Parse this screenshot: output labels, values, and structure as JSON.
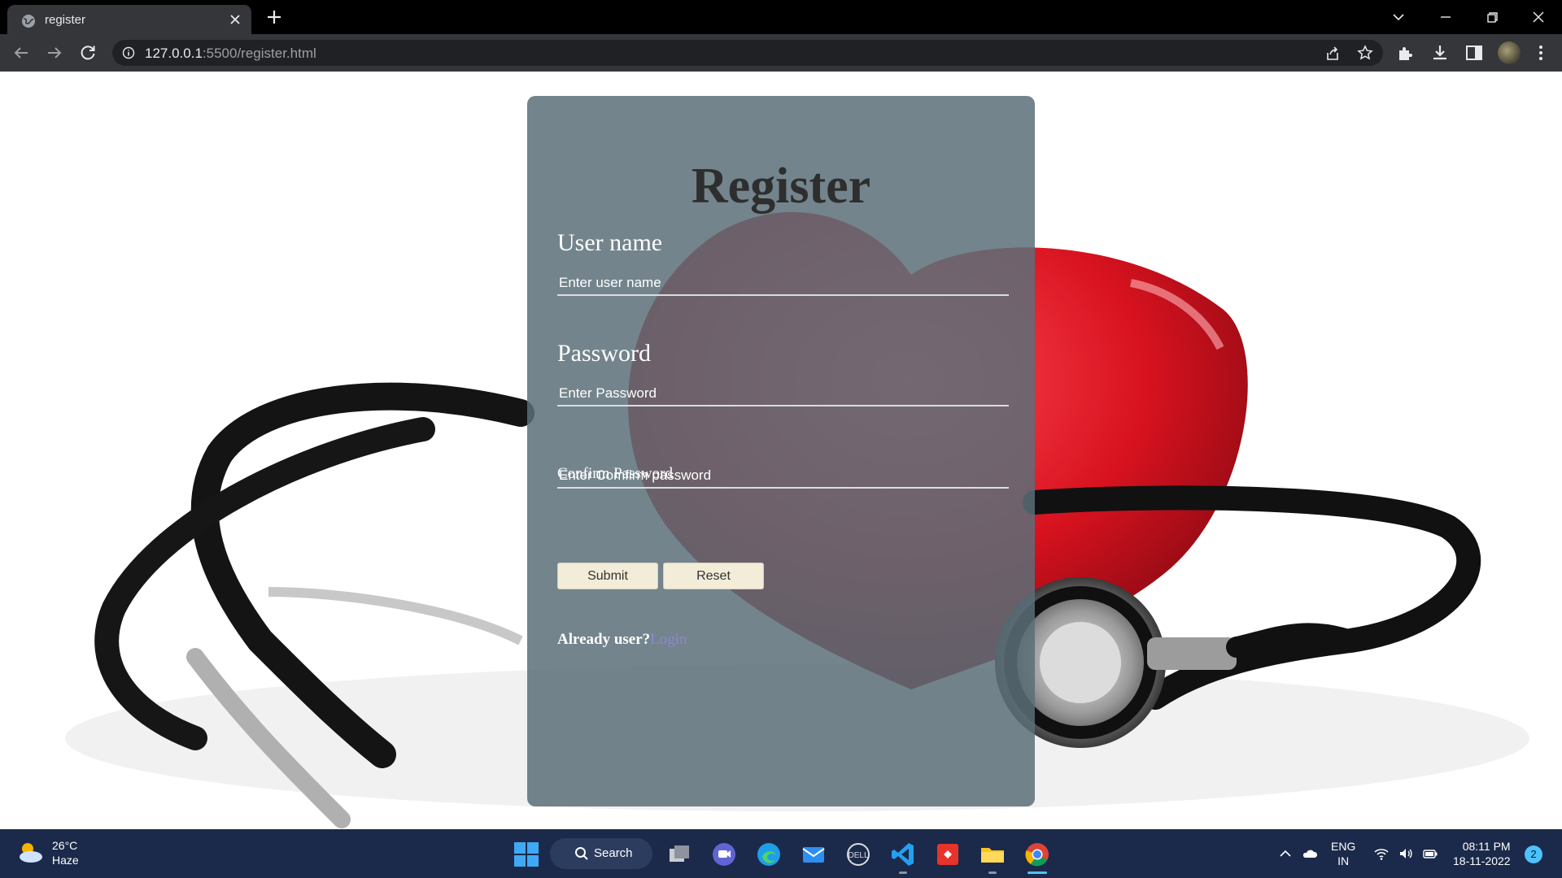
{
  "browser": {
    "tab_title": "register",
    "url_host": "127.0.0.1",
    "url_rest": ":5500/register.html"
  },
  "form": {
    "heading": "Register",
    "username_label": "User name",
    "username_placeholder": "Enter user name",
    "password_label": "Password",
    "password_placeholder": "Enter Password",
    "confirm_label": "Confirm Password",
    "confirm_placeholder": "Enter Comfirm password",
    "submit_label": "Submit",
    "reset_label": "Reset",
    "already_text": "Already user?",
    "login_link": "Login"
  },
  "taskbar": {
    "weather_temp": "26°C",
    "weather_cond": "Haze",
    "search_label": "Search",
    "lang_line1": "ENG",
    "lang_line2": "IN",
    "time": "08:11 PM",
    "date": "18-11-2022",
    "notification_count": "2"
  },
  "colors": {
    "card_overlay": "#5a6e78",
    "button_bg": "#f2ecd9",
    "login_link": "#8f84d6",
    "taskbar_bg": "#1b2a4a",
    "tab_bg": "#35363a"
  }
}
